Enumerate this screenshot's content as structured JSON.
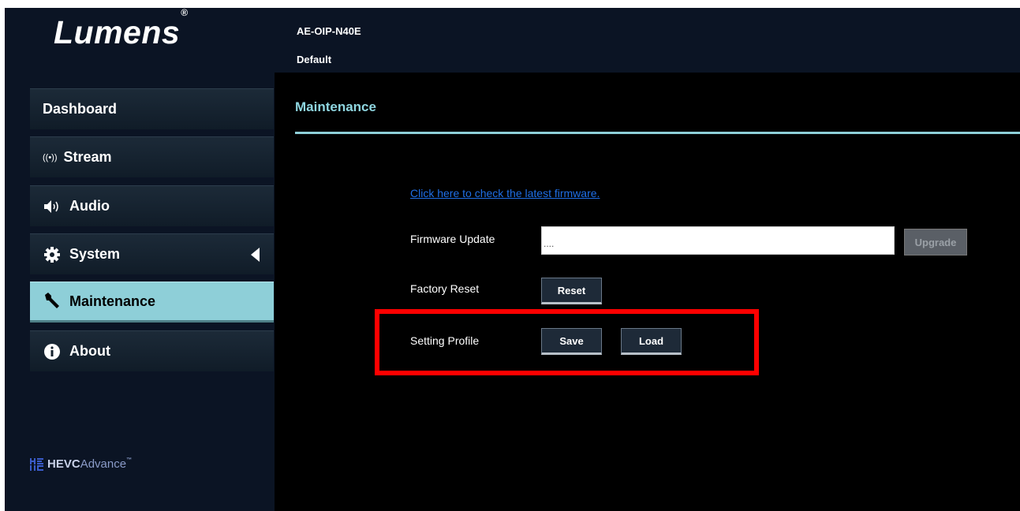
{
  "header": {
    "logo_text": "Lumens",
    "logo_mark": "®",
    "model": "AE-OIP-N40E",
    "profile": "Default"
  },
  "sidebar": {
    "items": [
      {
        "label": "Dashboard",
        "icon": null,
        "active": false
      },
      {
        "label": "Stream",
        "icon": "broadcast-icon",
        "icon_glyph": "((•))",
        "active": false
      },
      {
        "label": "Audio",
        "icon": "speaker-icon",
        "active": false
      },
      {
        "label": "System",
        "icon": "gear-icon",
        "active": false,
        "expand_indicator": "collapse-arrow"
      },
      {
        "label": "Maintenance",
        "icon": "wrench-icon",
        "active": true
      },
      {
        "label": "About",
        "icon": "info-icon",
        "active": false
      }
    ],
    "footer_logo": {
      "mark": "HEVC",
      "bold": "HEVC",
      "light": "Advance",
      "tm": "™"
    }
  },
  "main": {
    "title": "Maintenance",
    "firmware_link": "Click here to check the latest firmware.",
    "firmware_update": {
      "label": "Firmware Update",
      "value": "....",
      "button": "Upgrade",
      "button_enabled": false
    },
    "factory_reset": {
      "label": "Factory Reset",
      "button": "Reset"
    },
    "setting_profile": {
      "label": "Setting Profile",
      "save_button": "Save",
      "load_button": "Load",
      "highlighted": true
    }
  },
  "colors": {
    "accent": "#8ecfd8",
    "header_bg": "#0b1424",
    "link": "#1f6fe6",
    "highlight_box": "#ff0000"
  }
}
